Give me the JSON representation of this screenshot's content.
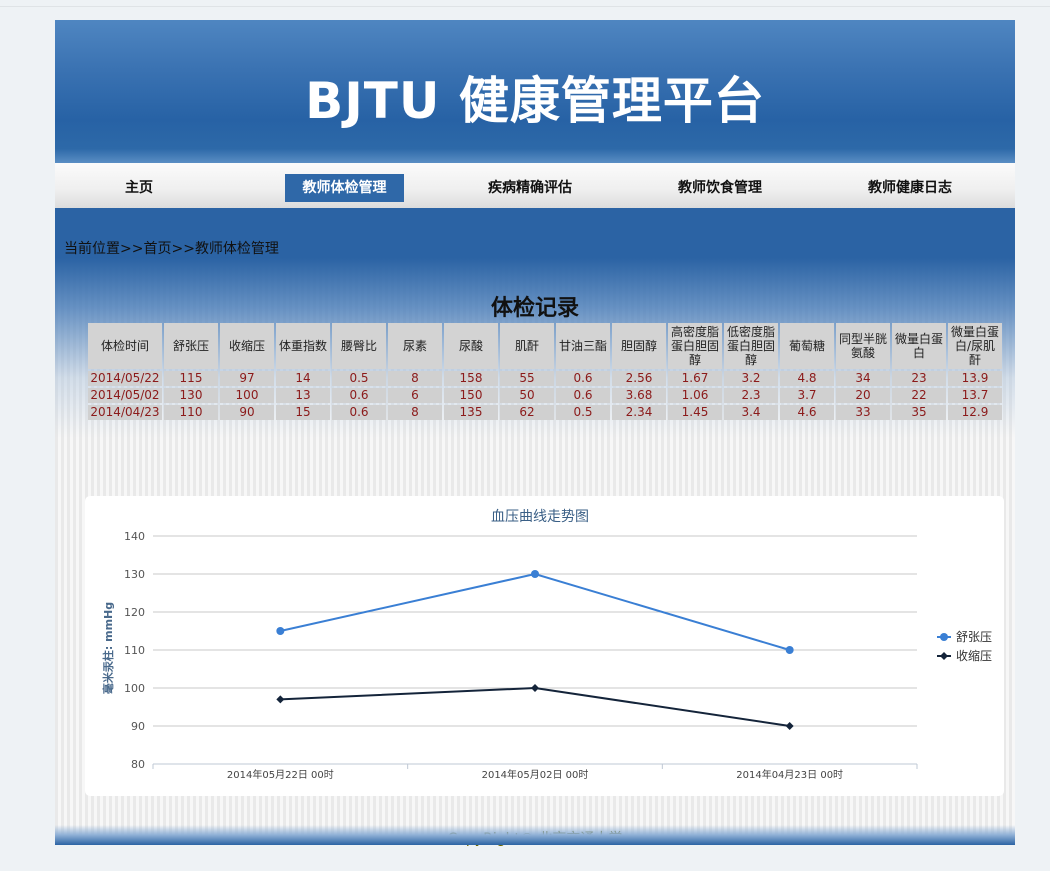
{
  "header": {
    "title": "BJTU 健康管理平台"
  },
  "nav": {
    "items": [
      {
        "label": "主页",
        "active": false
      },
      {
        "label": "教师体检管理",
        "active": true
      },
      {
        "label": "疾病精确评估",
        "active": false
      },
      {
        "label": "教师饮食管理",
        "active": false
      },
      {
        "label": "教师健康日志",
        "active": false
      }
    ]
  },
  "breadcrumb": {
    "prefix": "当前位置",
    "sep1": ">>",
    "home": "首页",
    "sep2": ">>",
    "current": "教师体检管理"
  },
  "records": {
    "title": "体检记录",
    "columns": [
      "体检时间",
      "舒张压",
      "收缩压",
      "体重指数",
      "腰臀比",
      "尿素",
      "尿酸",
      "肌酐",
      "甘油三酯",
      "胆固醇",
      "高密度脂蛋白胆固醇",
      "低密度脂蛋白胆固醇",
      "葡萄糖",
      "同型半胱氨酸",
      "微量白蛋白",
      "微量白蛋白/尿肌酐"
    ],
    "rows": [
      [
        "2014/05/22",
        "115",
        "97",
        "14",
        "0.5",
        "8",
        "158",
        "55",
        "0.6",
        "2.56",
        "1.67",
        "3.2",
        "4.8",
        "34",
        "23",
        "13.9"
      ],
      [
        "2014/05/02",
        "130",
        "100",
        "13",
        "0.6",
        "6",
        "150",
        "50",
        "0.6",
        "3.68",
        "1.06",
        "2.3",
        "3.7",
        "20",
        "22",
        "13.7"
      ],
      [
        "2014/04/23",
        "110",
        "90",
        "15",
        "0.6",
        "8",
        "135",
        "62",
        "0.5",
        "2.34",
        "1.45",
        "3.4",
        "4.6",
        "33",
        "35",
        "12.9"
      ]
    ]
  },
  "chart_data": {
    "type": "line",
    "title": "血压曲线走势图",
    "xlabel": "",
    "ylabel": "毫米汞柱: mmHg",
    "categories": [
      "2014年05月22日 00时",
      "2014年05月02日 00时",
      "2014年04月23日 00时"
    ],
    "series": [
      {
        "name": "舒张压",
        "values": [
          115,
          130,
          110
        ],
        "color": "#3a7fd4",
        "marker": "circle"
      },
      {
        "name": "收缩压",
        "values": [
          97,
          100,
          90
        ],
        "color": "#14243a",
        "marker": "diamond"
      }
    ],
    "ylim": [
      80,
      140
    ],
    "yticks": [
      80,
      90,
      100,
      110,
      120,
      130,
      140
    ],
    "grid": true,
    "legend": "right"
  },
  "footer": {
    "text": "CopyRight© 北京交通大学"
  }
}
